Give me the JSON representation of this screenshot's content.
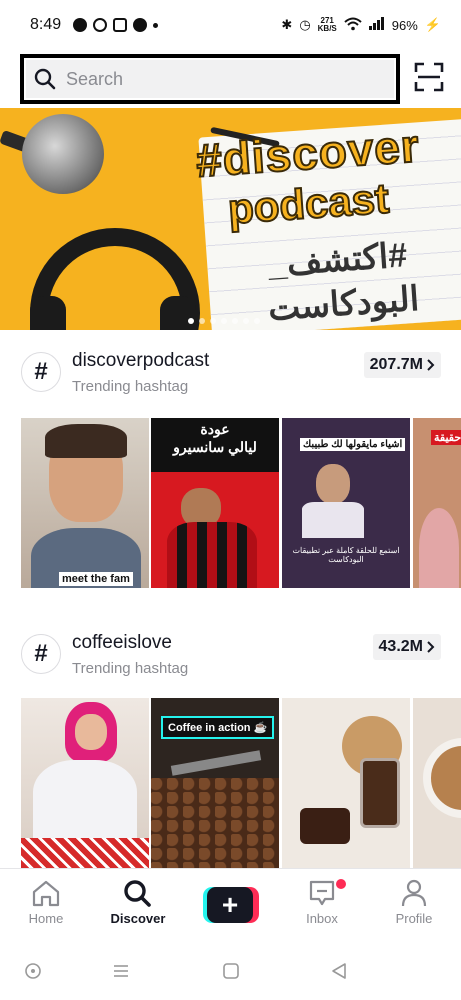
{
  "status_bar": {
    "time": "8:49",
    "network_speed_value": "271",
    "network_speed_unit": "KB/S",
    "battery": "96%"
  },
  "search": {
    "placeholder": "Search"
  },
  "sections": [
    {
      "hashtag": "discoverpodcast",
      "subtitle": "Trending hashtag",
      "count": "207.7M",
      "thumb_texts": {
        "t1": "meet the fam",
        "t2_line1": "عودة",
        "t2_line2": "ليالي سانسيرو",
        "t3_top": "اشياء مايقولها لك طبيبك",
        "t3_bottom": "استمع للحلقة كاملة عبر تطبيقات البودكاست",
        "t4": "حقيقة"
      }
    },
    {
      "hashtag": "coffeeislove",
      "subtitle": "Trending hashtag",
      "count": "43.2M",
      "thumb_texts": {
        "t2": "Coffee in action ☕"
      }
    }
  ],
  "banner": {
    "line1": "#discover",
    "line2": "podcast",
    "line3": "#اكتشف_",
    "line4": "البودكاست"
  },
  "nav": {
    "home": "Home",
    "discover": "Discover",
    "create": "+",
    "inbox": "Inbox",
    "profile": "Profile"
  },
  "colors": {
    "accent_red": "#fe2c55",
    "accent_cyan": "#25f4ee",
    "text": "#161823",
    "muted": "#8a8b91"
  }
}
